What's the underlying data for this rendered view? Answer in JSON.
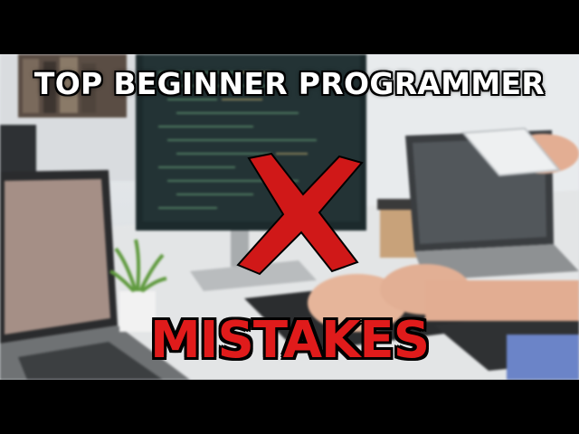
{
  "thumbnail": {
    "title": "TOP BEGINNER PROGRAMMER",
    "subtitle": "MISTAKES",
    "colors": {
      "title_text": "#ffffff",
      "subtitle_text": "#e01b1b",
      "x_mark": "#d01818",
      "outline": "#000000"
    },
    "icons": [
      "x-mark-icon"
    ]
  }
}
